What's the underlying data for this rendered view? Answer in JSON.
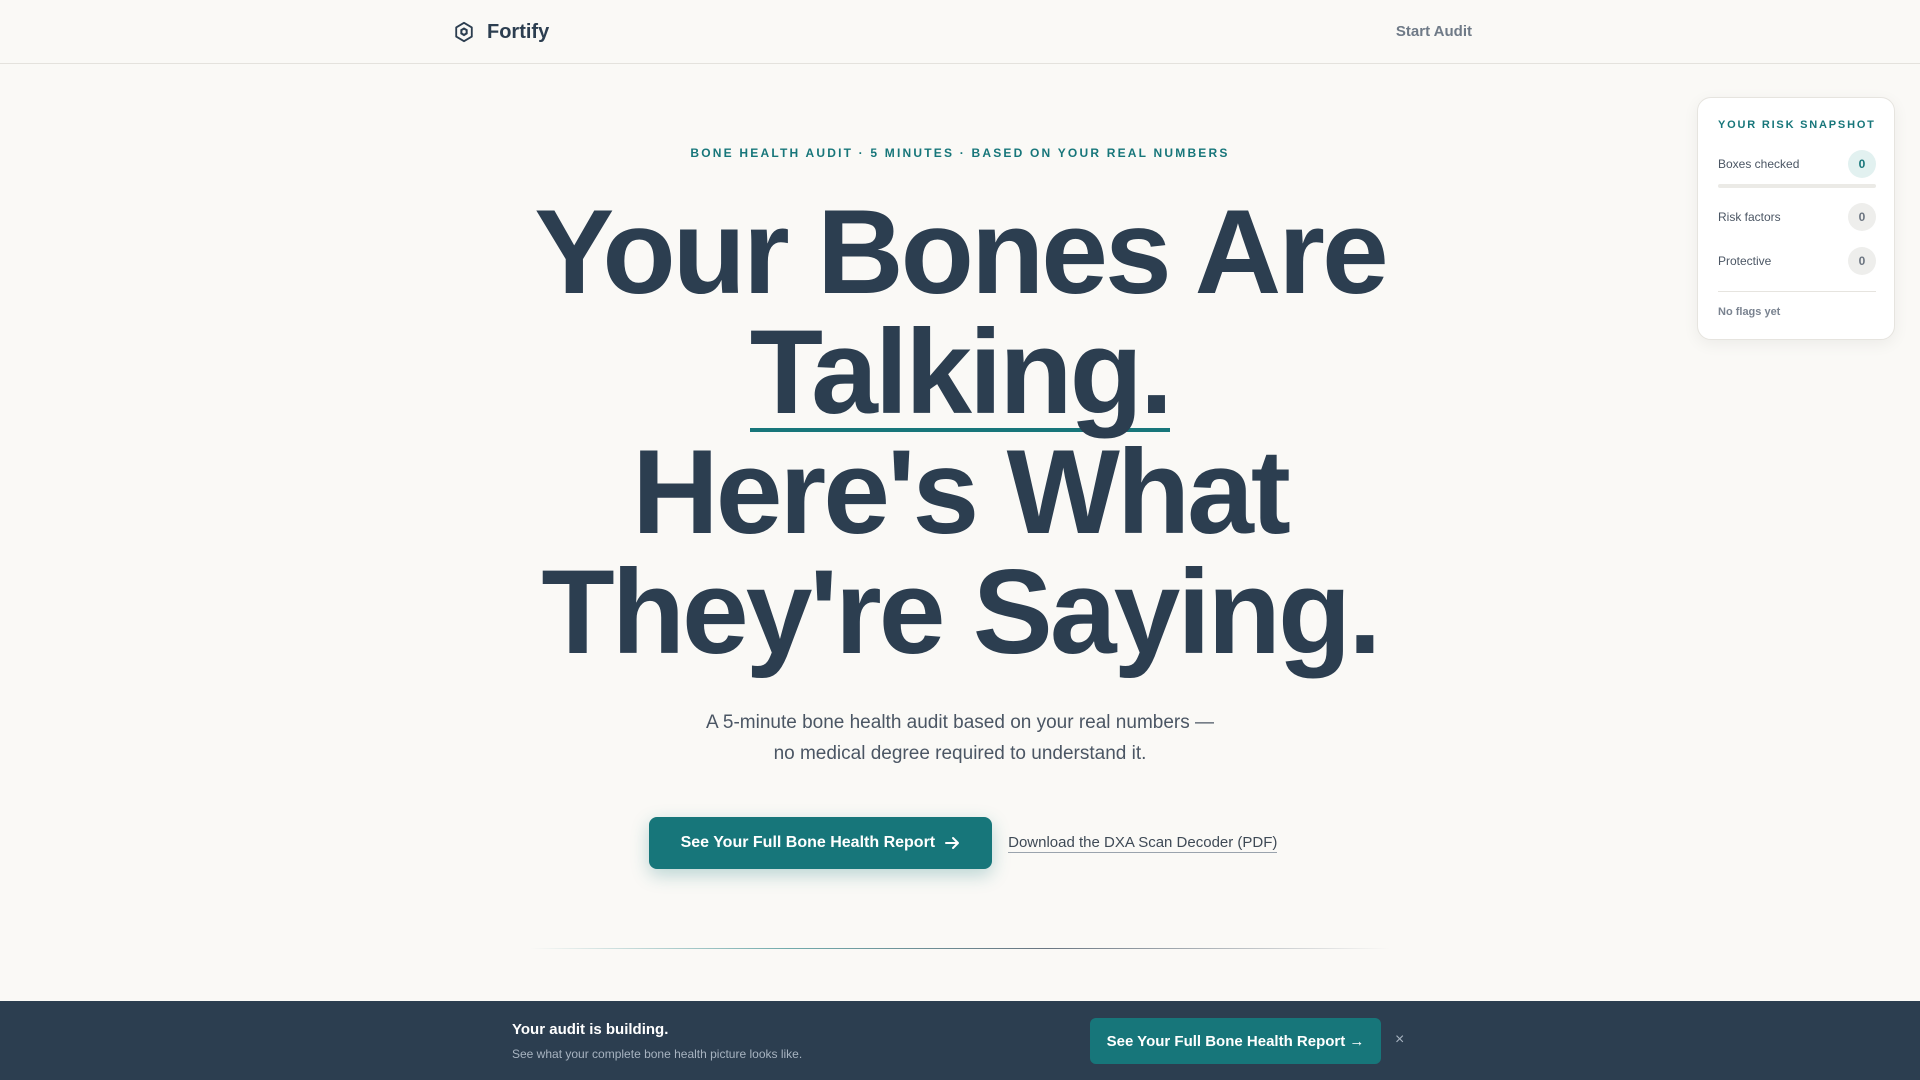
{
  "header": {
    "brand_name": "Fortify",
    "brand_icon": "hexagon-shield-icon",
    "nav_link": "Start Audit"
  },
  "hero": {
    "eyebrow": "BONE HEALTH AUDIT · 5 MINUTES · BASED ON YOUR REAL NUMBERS",
    "headline_line1": "Your Bones Are",
    "headline_line2": "Talking.",
    "headline_line3": "Here's What",
    "headline_line4": "They're Saying.",
    "subtext_line1": "A 5-minute bone health audit based on your real numbers —",
    "subtext_line2": "no medical degree required to understand it.",
    "primary_cta": "See Your Full Bone Health Report",
    "primary_cta_icon": "arrow-right-icon",
    "secondary_cta": "Download the DXA Scan Decoder (PDF)"
  },
  "risk_snapshot": {
    "title": "YOUR RISK SNAPSHOT",
    "rows": [
      {
        "label": "Boxes checked",
        "count": "0"
      },
      {
        "label": "Risk factors",
        "count": "0"
      },
      {
        "label": "Protective",
        "count": "0"
      }
    ],
    "progress_fraction": 0,
    "flags_text": "No flags yet"
  },
  "bottom_bar": {
    "title": "Your audit is building.",
    "subtitle": "See what your complete bone health picture looks like.",
    "cta": "See Your Full Bone Health Report →",
    "close": "×"
  },
  "colors": {
    "accent": "#17767a",
    "text_dark": "#2c3e50",
    "background": "#faf9f6",
    "bottom_bar": "#2c3e50"
  }
}
